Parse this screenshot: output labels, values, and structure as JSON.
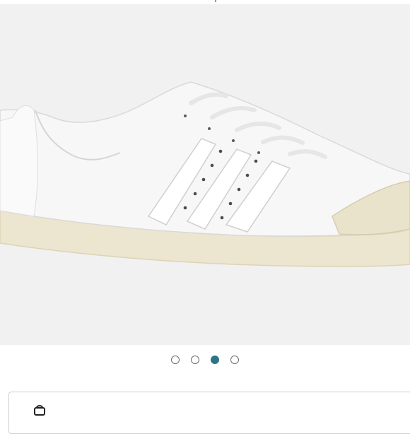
{
  "carousel": {
    "total_slides": 4,
    "active_index": 2
  },
  "product_image": {
    "subject": "sneaker-icon"
  },
  "colors": {
    "frame_background": "#f1f1f1",
    "active_dot": "#2e7487",
    "inactive_dot_border": "#6b6b6b"
  },
  "bottom_card": {
    "icon": "bag-icon"
  }
}
